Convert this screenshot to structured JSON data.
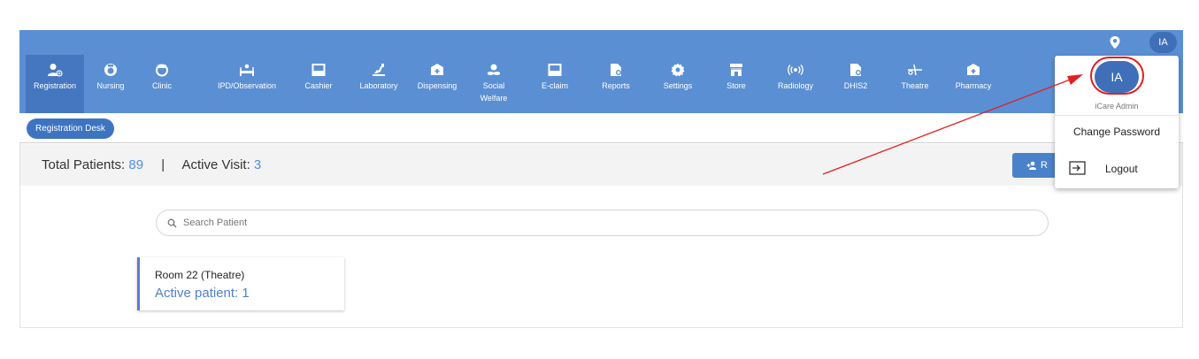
{
  "header": {
    "user_initials": "IA",
    "location_icon": "map-pin-icon"
  },
  "nav": {
    "items": [
      {
        "label": "Registration",
        "icon": "user-add-icon"
      },
      {
        "label": "Nursing",
        "icon": "nurse-icon"
      },
      {
        "label": "Clinic",
        "icon": "doctor-icon"
      },
      {
        "label": "IPD/Observation",
        "icon": "bed-icon"
      },
      {
        "label": "Cashier",
        "icon": "cash-register-icon"
      },
      {
        "label": "Laboratory",
        "icon": "microscope-icon"
      },
      {
        "label": "Dispensing",
        "icon": "medicine-box-icon"
      },
      {
        "label": "Social",
        "label2": "Welfare",
        "icon": "hand-heart-icon"
      },
      {
        "label": "E-claim",
        "icon": "claim-icon"
      },
      {
        "label": "Reports",
        "icon": "report-icon"
      },
      {
        "label": "Settings",
        "icon": "gear-icon"
      },
      {
        "label": "Store",
        "icon": "store-icon"
      },
      {
        "label": "Radiology",
        "icon": "radiation-icon"
      },
      {
        "label": "DHIS2",
        "icon": "document-icon"
      },
      {
        "label": "Theatre",
        "icon": "scissors-icon"
      },
      {
        "label": "Pharmacy",
        "icon": "medicine-box-icon"
      }
    ]
  },
  "subbar": {
    "chip_label": "Registration Desk"
  },
  "stats": {
    "total_label": "Total Patients:",
    "total_value": "89",
    "separator": "|",
    "active_label": "Active Visit:",
    "active_value": "3",
    "register_button_label": "R"
  },
  "search": {
    "placeholder": "Search Patient"
  },
  "room_card": {
    "name": "Room 22 (Theatre)",
    "active": "Active patient: 1"
  },
  "user_menu": {
    "initials": "IA",
    "name": "iCare Admin",
    "change_password": "Change Password",
    "logout": "Logout"
  },
  "colors": {
    "nav_bg": "#5b8fd3",
    "active_nav": "#4577c0",
    "accent": "#4f8fe0",
    "annotation_red": "#e02020"
  }
}
